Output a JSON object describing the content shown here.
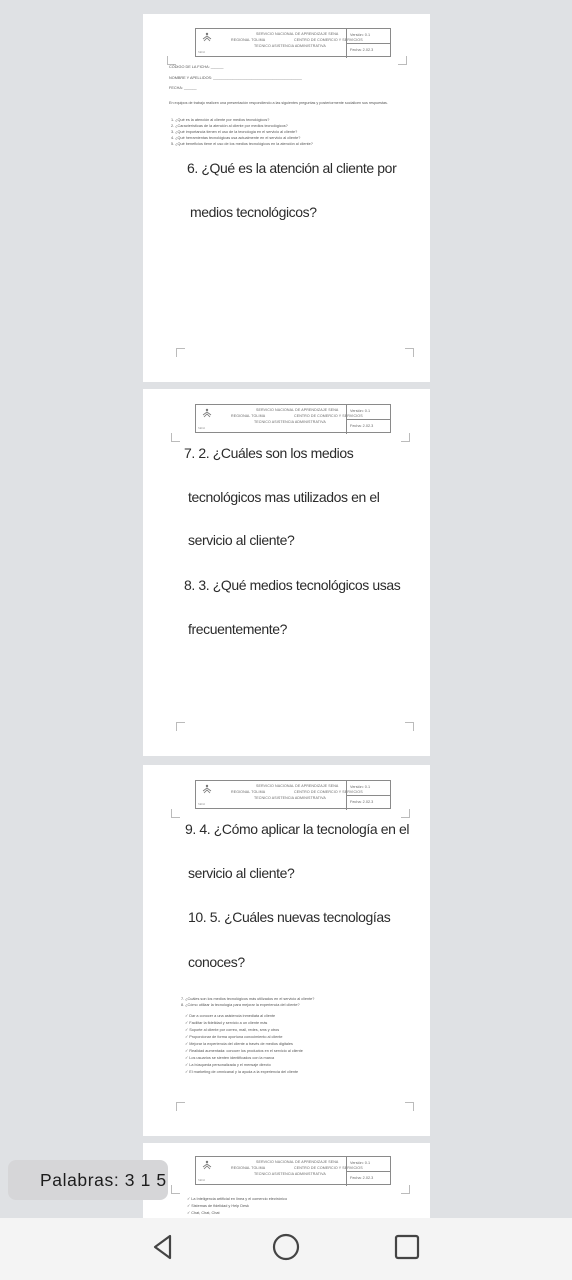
{
  "header": {
    "org_line1": "SERVICIO NACIONAL DE APRENDIZAJE SENA",
    "org_line2a": "REGIONAL TOLIMA",
    "org_line2b": "CENTRO DE COMERCIO Y SERVICIOS",
    "org_line3": "TECNICO ASISTENCIA ADMINISTRATIVA",
    "version": "Versión: 0.1",
    "date": "Fecha: 2.02.3",
    "logo_caption": "SENA"
  },
  "page1": {
    "field_code": "CÓDIGO DE LA FICHA: ______",
    "field_name": "NOMBRE Y APELLIDOS: __________________________________________",
    "field_date": "FECHA: ______",
    "instructions": "En equipos de trabajo realicen una presentación respondiendo a las siguientes preguntas y posteriormente socialicen sus respuestas.",
    "questions": [
      "1. ¿Qué es la atención al cliente por medios tecnológicos?",
      "2. ¿Características de la atención al cliente por medios tecnológicos?",
      "3. ¿Qué importancia tienen el uso de la tecnología en el servicio al cliente?",
      "4. ¿Qué herramientas tecnológicas usa actualmente en el servicio al cliente?",
      "5. ¿Qué beneficios tiene el uso de los medios tecnológicos en la atención al cliente?"
    ],
    "hw_line1": "6. ¿Qué es la atención al cliente por",
    "hw_line2": "medios tecnológicos?"
  },
  "page2": {
    "hw_line1": "7. 2. ¿Cuáles son los medios",
    "hw_line2": "tecnológicos mas utilizados en el",
    "hw_line3": "servicio al cliente?",
    "hw_line4": "8. 3. ¿Qué medios tecnológicos usas",
    "hw_line5": "frecuentemente?"
  },
  "page3": {
    "hw_line1": "9. 4. ¿Cómo aplicar la tecnología en el",
    "hw_line2": "servicio al cliente?",
    "hw_line3": "10. 5. ¿Cuáles nuevas tecnologías",
    "hw_line4": "conoces?",
    "questions": [
      "7. ¿Cuáles son los medios tecnológicos más utilizados en el servicio al cliente?",
      "8. ¿Cómo utilizar la tecnología para mejorar la experiencia del cliente?"
    ],
    "bullets": [
      "Dar a conocer a una asistencia inmediata al cliente",
      "Facilitar la fidelidad y servicio a un cliente más",
      "Soporte al cliente por correo, mail, redes, sms y otros",
      "Proporcionar de forma oportuna conocimiento al cliente",
      "Mejorar la experiencia del cliente a través de medios digitales",
      "Realidad aumentada: conocer los productos en el servicio al cliente",
      "Los usuarios se sienten identificados con la marca",
      "La búsqueda personalizada y el mensaje directo",
      "El marketing de omnicanal y la ayuda a la experiencia del cliente"
    ]
  },
  "page4": {
    "bullets": [
      "La Inteligencia artificial en línea y el comercio electrónico",
      "Sistemas de fidelidad y Help Desk",
      "Chat, Chat, Chat"
    ]
  },
  "word_count": "Palabras: 3 1 5",
  "nav": {
    "back_icon": "triangle-back-icon",
    "home_icon": "circle-home-icon",
    "recents_icon": "square-recents-icon"
  }
}
